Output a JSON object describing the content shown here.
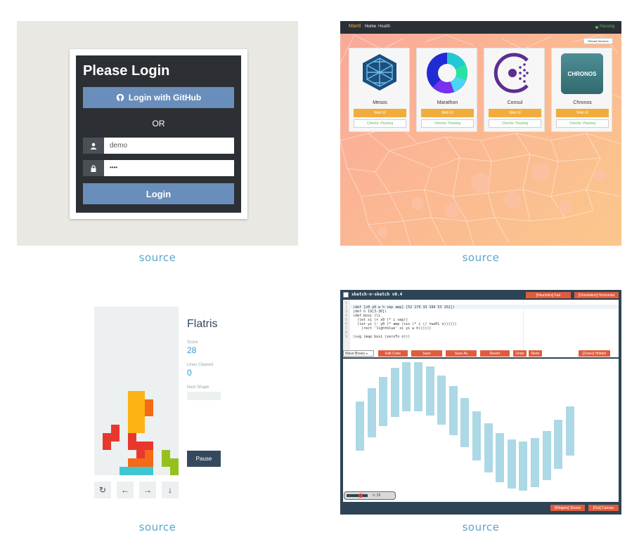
{
  "source_label": "source",
  "login": {
    "title": "Please Login",
    "github_button": "Login with GitHub",
    "or": "OR",
    "username_value": "demo",
    "password_value": "••••",
    "login_button": "Login"
  },
  "mantl": {
    "brand": "Mantl",
    "nav": [
      "Home",
      "Health"
    ],
    "status": "Passing",
    "reload_button": "Reload Services",
    "services": [
      {
        "name": "Mesos",
        "web": "Web UI",
        "checks": "Checks: Passing"
      },
      {
        "name": "Marathon",
        "web": "Web UI",
        "checks": "Checks: Passing"
      },
      {
        "name": "Consul",
        "web": "Web UI",
        "checks": "Checks: Passing"
      },
      {
        "name": "Chronos",
        "web": "Web UI",
        "checks": "Checks: Passing",
        "logo_text": "CHRONOS"
      }
    ]
  },
  "flatris": {
    "title": "Flatris",
    "score_label": "Score",
    "score_value": "28",
    "lines_label": "Lines Cleared",
    "lines_value": "0",
    "next_label": "Next Shape",
    "pause_button": "Pause",
    "controls": [
      "↻",
      "←",
      "→",
      "↓"
    ]
  },
  "sketch": {
    "title": "sketch-n-sketch v0.4",
    "heuristics": "[Heuristics] Fair",
    "orientation": "[Orientation] Horizontal",
    "code_lines": [
      "",
      "(def [x0 y0 w h sep amp] [52 179 33 199 53 152])",
      "(def n 19[3-30])",
      "(def boxi (\\i",
      "  (let xi (+ x0 (* i sep))",
      "  (let yi (- y0 (* amp (sin (* i (/ twoPi n))))))",
      "    (rect 'lightblue' xi yi w h))))))",
      "",
      "(svg (map boxi (zeroTo n)))"
    ],
    "dropdown": "Wave Boxes",
    "buttons": [
      "Edit Code",
      "Save",
      "Save As",
      "Revert",
      "Undo",
      "Redo"
    ],
    "zones": "[Zones] Hidden",
    "slider_label": "n: 19",
    "widgets": "[Widgets] Shown",
    "out": "[Out] Canvas",
    "chart_data": {
      "type": "bar",
      "series": [
        {
          "values": [
            0.0,
            0.33,
            0.61,
            0.84,
            0.98,
            0.99,
            0.87,
            0.65,
            0.38,
            0.08,
            -0.25,
            -0.54,
            -0.79,
            -0.95,
            -1.0,
            -0.92,
            -0.73,
            -0.45,
            -0.12
          ]
        }
      ]
    }
  }
}
